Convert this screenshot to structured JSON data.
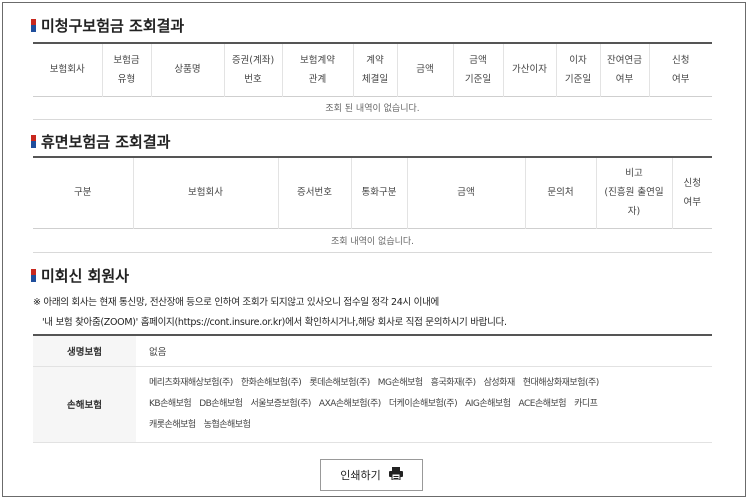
{
  "unclaimed": {
    "title": "미청구보험금 조회결과",
    "headers": [
      [
        "보험회사"
      ],
      [
        "보험금",
        "유형"
      ],
      [
        "상품명"
      ],
      [
        "증권(계좌)",
        "번호"
      ],
      [
        "보험계약",
        "관계"
      ],
      [
        "계약",
        "체결일"
      ],
      [
        "금액"
      ],
      [
        "금액",
        "기준일"
      ],
      [
        "가산이자"
      ],
      [
        "이자",
        "기준일"
      ],
      [
        "잔여연금",
        "여부"
      ],
      [
        "신청",
        "여부"
      ]
    ],
    "empty_message": "조회 된 내역이 없습니다."
  },
  "dormant": {
    "title": "휴면보험금 조회결과",
    "headers": [
      [
        "구분"
      ],
      [
        "보험회사"
      ],
      [
        "증서번호"
      ],
      [
        "통화구분"
      ],
      [
        "금액"
      ],
      [
        "문의처"
      ],
      [
        "비고",
        "(진흥원 출연일",
        "자)"
      ],
      [
        "신청",
        "여부"
      ]
    ],
    "empty_message": "조회 내역이 없습니다."
  },
  "non_member": {
    "title": "미회신 회원사",
    "notice_line1": "※ 아래의 회사는 현재 통신망, 전산장애 등으로 인하여 조회가 되지않고 있사오니 접수일 정각 24시 이내에",
    "notice_line2": "'내 보험 찾아줌(ZOOM)' 홈페이지(https://cont.insure.or.kr)에서 확인하시거나,해당 회사로 직접 문의하시기 바랍니다.",
    "life": {
      "label": "생명보험",
      "value": "없음"
    },
    "nonlife": {
      "label": "손해보험",
      "companies": [
        "메리츠화재해상보험(주)",
        "한화손해보험(주)",
        "롯데손해보험(주)",
        "MG손해보험",
        "흥국화재(주)",
        "삼성화재",
        "현대해상화재보험(주)",
        "KB손해보험",
        "DB손해보험",
        "서울보증보험(주)",
        "AXA손해보험(주)",
        "더케이손해보험(주)",
        "AIG손해보험",
        "ACE손해보험",
        "카디프",
        "캐롯손해보험",
        "농협손해보험"
      ]
    }
  },
  "print_button": {
    "label": "인쇄하기",
    "icon": "printer-icon"
  }
}
